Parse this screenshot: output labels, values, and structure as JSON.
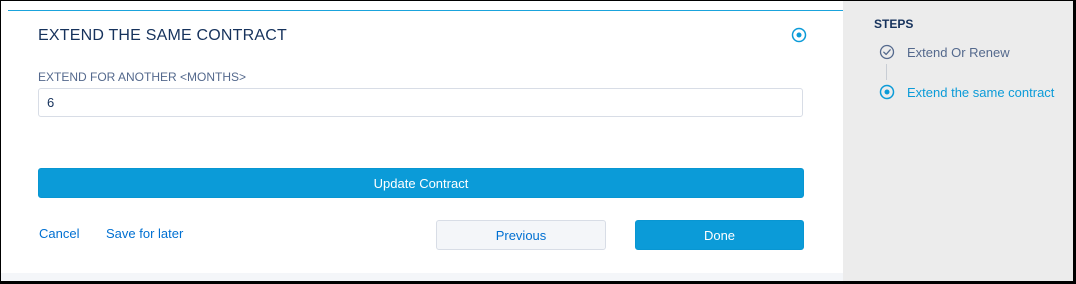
{
  "form": {
    "title": "EXTEND THE SAME CONTRACT",
    "field_label": "EXTEND FOR ANOTHER <MONTHS>",
    "field_value": "6",
    "update_button": "Update Contract",
    "cancel_link": "Cancel",
    "save_link": "Save for later",
    "previous_button": "Previous",
    "done_button": "Done"
  },
  "sidebar": {
    "heading": "STEPS",
    "steps": [
      {
        "label": "Extend Or Renew",
        "state": "completed",
        "icon": "check-circle-icon"
      },
      {
        "label": "Extend the same contract",
        "state": "current",
        "icon": "radio-current-icon"
      }
    ]
  },
  "colors": {
    "accent": "#0b9bd8",
    "link": "#0070d2",
    "text": "#16325c",
    "muted": "#54698d"
  }
}
